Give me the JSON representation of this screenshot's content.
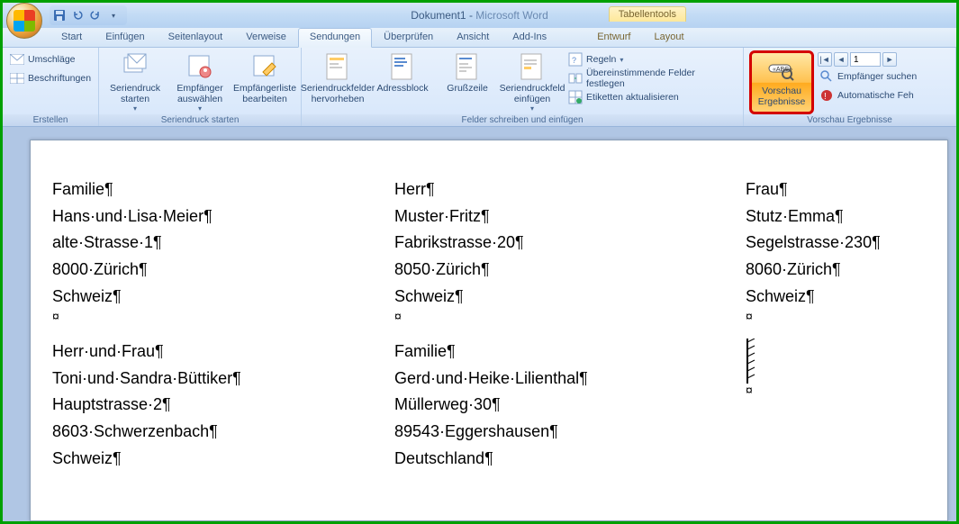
{
  "title": {
    "doc": "Dokument1",
    "app": "Microsoft Word"
  },
  "context_tab_title": "Tabellentools",
  "tabs": [
    "Start",
    "Einfügen",
    "Seitenlayout",
    "Verweise",
    "Sendungen",
    "Überprüfen",
    "Ansicht",
    "Add-Ins",
    "Entwurf",
    "Layout"
  ],
  "active_tab": "Sendungen",
  "ribbon": {
    "erstellen": {
      "label": "Erstellen",
      "umschlaege": "Umschläge",
      "beschriftungen": "Beschriftungen"
    },
    "seriendruck_starten": {
      "label": "Seriendruck starten",
      "start": "Seriendruck starten",
      "empf_ausw": "Empfänger auswählen",
      "empf_bearb": "Empfängerliste bearbeiten"
    },
    "felder": {
      "label": "Felder schreiben und einfügen",
      "hervorheben": "Seriendruckfelder hervorheben",
      "adressblock": "Adressblock",
      "grusszeile": "Grußzeile",
      "feld_einf": "Seriendruckfeld einfügen",
      "regeln": "Regeln",
      "uebereinst": "Übereinstimmende Felder festlegen",
      "etiketten": "Etiketten aktualisieren"
    },
    "vorschau": {
      "label": "Vorschau Ergebnisse",
      "vorschau_btn": "Vorschau Ergebnisse",
      "record": "1",
      "empf_suchen": "Empfänger suchen",
      "auto_fehler": "Automatische Feh"
    }
  },
  "labels": [
    [
      [
        "Familie¶",
        "Hans·und·Lisa·Meier¶",
        "alte·Strasse·1¶",
        "8000·Zürich¶",
        "Schweiz¶",
        "¤"
      ],
      [
        "Herr¶",
        "Muster·Fritz¶",
        "Fabrikstrasse·20¶",
        "8050·Zürich¶",
        "Schweiz¶",
        "¤"
      ],
      [
        "Frau¶",
        "Stutz·Emma¶",
        "Segelstrasse·230¶",
        "8060·Zürich¶",
        "Schweiz¶",
        "¤"
      ]
    ],
    [
      [
        "Herr·und·Frau¶",
        "Toni·und·Sandra·Büttiker¶",
        "Hauptstrasse·2¶",
        "8603·Schwerzenbach¶",
        "Schweiz¶"
      ],
      [
        "Familie¶",
        "Gerd·und·Heike·Lilienthal¶",
        "Müllerweg·30¶",
        "89543·Eggershausen¶",
        "Deutschland¶"
      ],
      [
        "",
        "",
        "",
        "¤"
      ]
    ]
  ]
}
